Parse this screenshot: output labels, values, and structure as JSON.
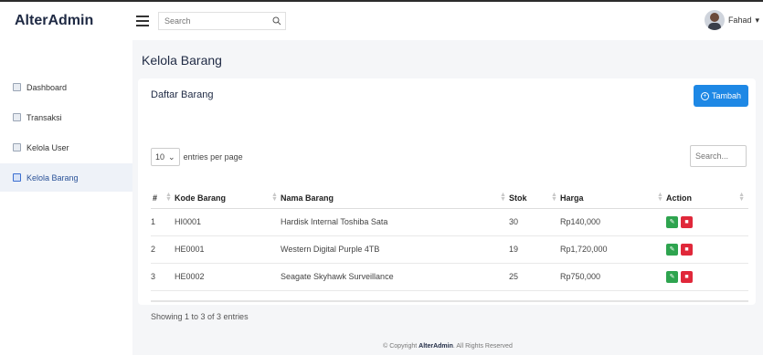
{
  "app": {
    "brand": "AlterAdmin"
  },
  "search": {
    "placeholder": "Search"
  },
  "user": {
    "name": "Fahad"
  },
  "sidebar": {
    "items": [
      {
        "label": "Dashboard"
      },
      {
        "label": "Transaksi"
      },
      {
        "label": "Kelola User"
      },
      {
        "label": "Kelola Barang"
      }
    ]
  },
  "page": {
    "title": "Kelola Barang"
  },
  "card": {
    "title": "Daftar Barang",
    "add_label": "Tambah",
    "entries_value": "10",
    "entries_label": "entries per page",
    "search_placeholder": "Search...",
    "columns": [
      "#",
      "Kode Barang",
      "Nama Barang",
      "Stok",
      "Harga",
      "Action"
    ],
    "rows": [
      {
        "no": "1",
        "kode": "HI0001",
        "nama": "Hardisk Internal Toshiba Sata",
        "stok": "30",
        "harga": "Rp140,000"
      },
      {
        "no": "2",
        "kode": "HE0001",
        "nama": "Western Digital Purple 4TB",
        "stok": "19",
        "harga": "Rp1,720,000"
      },
      {
        "no": "3",
        "kode": "HE0002",
        "nama": "Seagate Skyhawk Surveillance",
        "stok": "25",
        "harga": "Rp750,000"
      }
    ],
    "showing": "Showing 1 to 3 of 3 entries"
  },
  "footer": {
    "prefix": "© Copyright",
    "brand": "AlterAdmin",
    "suffix": ". All Rights Reserved"
  }
}
